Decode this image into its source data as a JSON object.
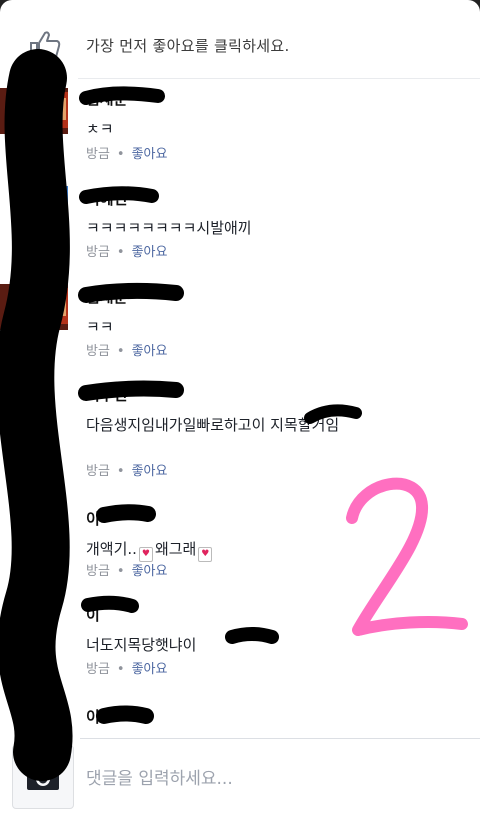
{
  "header": {
    "like_prompt": "가장 먼저 좋아요를 클릭하세요."
  },
  "comments": [
    {
      "name": "엄재준",
      "text": "ㅊㅋ",
      "time": "방금",
      "like": "좋아요"
    },
    {
      "name": "이혜민",
      "text": "ㅋㅋㅋㅋㅋㅋㅋㅋ시발애끼",
      "time": "방금",
      "like": "좋아요"
    },
    {
      "name": "엄재준",
      "text": "ㅋㅋ",
      "time": "방금",
      "like": "좋아요"
    },
    {
      "name": "이수민",
      "text": "다음생지임내가일빠로하고이 지목할거임",
      "time": "방금",
      "like": "좋아요"
    },
    {
      "name": "이",
      "text_a": "개액기..",
      "text_b": "왜그래",
      "time": "방금",
      "like": "좋아요"
    },
    {
      "name": "이",
      "text": "너도지목당햇냐이",
      "time": "방금",
      "like": "좋아요"
    },
    {
      "name": "이"
    }
  ],
  "composer": {
    "placeholder": "댓글을 입력하세요..."
  },
  "icons": {
    "like": "thumbs-up-icon",
    "camera": "camera-icon",
    "emoji": "heart-card-emoji-icon"
  },
  "annotation": {
    "number": "2"
  },
  "colors": {
    "link": "#4b66a0",
    "meta": "#90949c",
    "annotation": "#ff6fc0"
  }
}
